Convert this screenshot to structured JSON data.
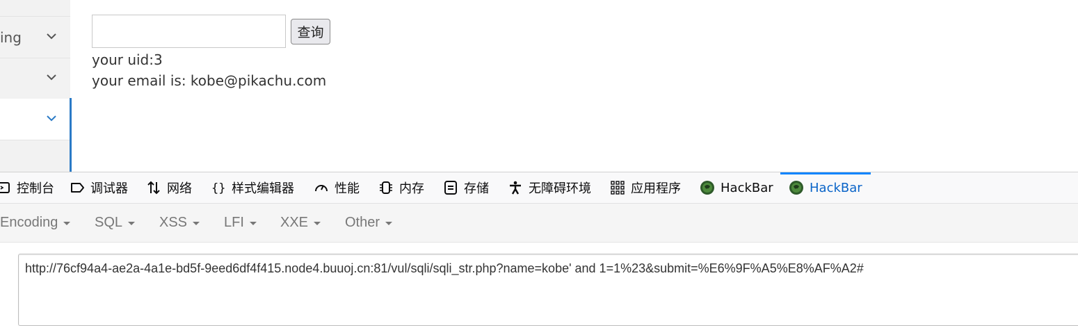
{
  "sidebar": {
    "items": [
      {
        "label": "ing"
      },
      {
        "label": ""
      },
      {
        "label": ""
      }
    ]
  },
  "main": {
    "query_button": "查询",
    "results": [
      "your uid:3",
      "your email is: kobe@pikachu.com"
    ]
  },
  "devtools": {
    "tabs": [
      {
        "label": "控制台",
        "icon": "console-icon"
      },
      {
        "label": "调试器",
        "icon": "debugger-icon"
      },
      {
        "label": "网络",
        "icon": "network-icon"
      },
      {
        "label": "样式编辑器",
        "icon": "style-editor-icon"
      },
      {
        "label": "性能",
        "icon": "performance-icon"
      },
      {
        "label": "内存",
        "icon": "memory-icon"
      },
      {
        "label": "存储",
        "icon": "storage-icon"
      },
      {
        "label": "无障碍环境",
        "icon": "accessibility-icon"
      },
      {
        "label": "应用程序",
        "icon": "application-icon"
      },
      {
        "label": "HackBar",
        "icon": "hackbar-icon"
      },
      {
        "label": "HackBar",
        "icon": "hackbar-icon"
      }
    ],
    "selected_tab": 10,
    "accent_color": "#0a84ff"
  },
  "hackbar": {
    "menus": [
      "Encoding",
      "SQL",
      "XSS",
      "LFI",
      "XXE",
      "Other"
    ],
    "url": "http://76cf94a4-ae2a-4a1e-bd5f-9eed6df4f415.node4.buuoj.cn:81/vul/sqli/sqli_str.php?name=kobe' and 1=1%23&submit=%E6%9F%A5%E8%AF%A2#"
  }
}
